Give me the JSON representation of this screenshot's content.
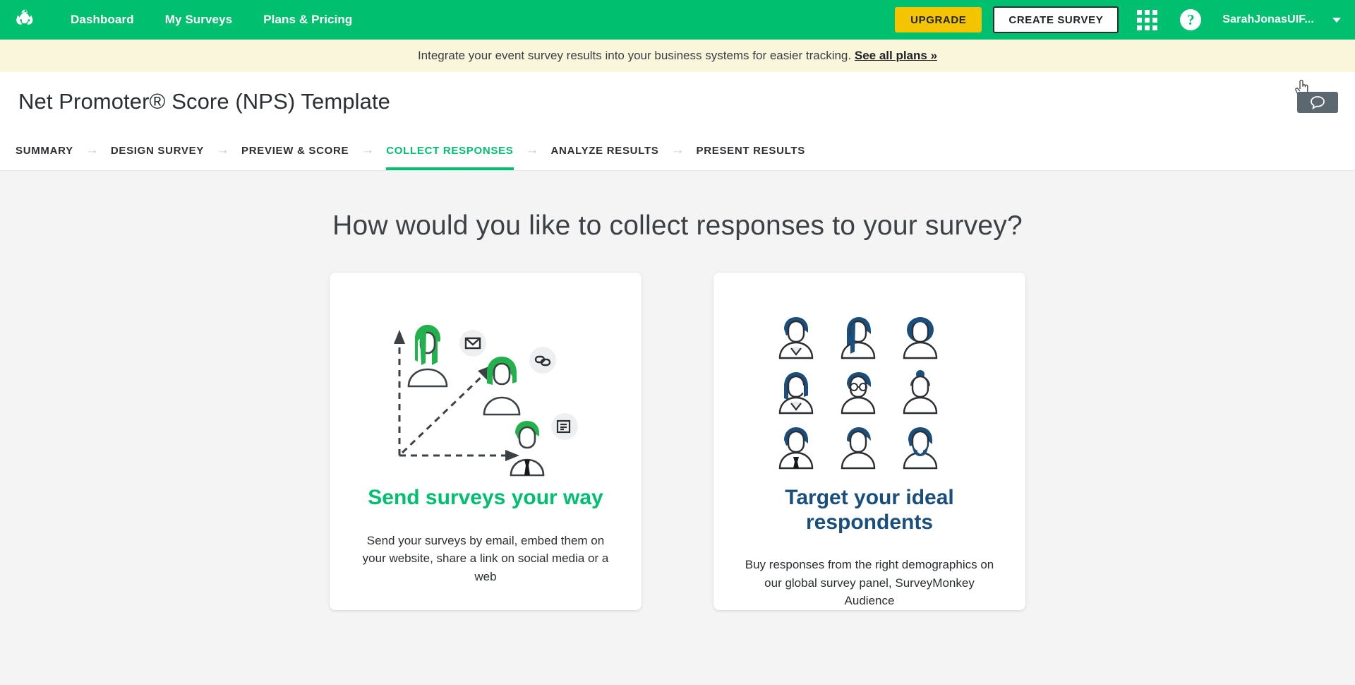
{
  "colors": {
    "brand_green": "#00bf6f",
    "upgrade_yellow": "#f5c400",
    "banner_bg": "#faf6dc",
    "navy": "#1a4f7d",
    "page_bg": "#f4f4f4",
    "feedback_tab": "#5b6870"
  },
  "topnav": {
    "logo_icon": "surveymonkey-logo-icon",
    "links": [
      {
        "label": "Dashboard"
      },
      {
        "label": "My Surveys"
      },
      {
        "label": "Plans & Pricing"
      }
    ],
    "upgrade_label": "UPGRADE",
    "create_survey_label": "CREATE SURVEY",
    "grid_icon": "apps-grid-icon",
    "help_icon": "help-question-icon",
    "help_glyph": "?",
    "username": "SarahJonasUIF...",
    "caret_icon": "chevron-down-icon"
  },
  "banner": {
    "text": "Integrate your event survey results into your business systems for easier tracking.",
    "link_label": "See all plans »"
  },
  "titlebar": {
    "title": "Net Promoter® Score (NPS) Template",
    "feedback_icon": "speech-bubble-icon",
    "cursor_icon": "pointing-hand-cursor-icon"
  },
  "tabs": {
    "separator": "→",
    "items": [
      {
        "label": "SUMMARY",
        "active": false
      },
      {
        "label": "DESIGN SURVEY",
        "active": false
      },
      {
        "label": "PREVIEW & SCORE",
        "active": false
      },
      {
        "label": "COLLECT RESPONSES",
        "active": true
      },
      {
        "label": "ANALYZE RESULTS",
        "active": false
      },
      {
        "label": "PRESENT RESULTS",
        "active": false
      }
    ]
  },
  "main": {
    "heading": "How would you like to collect responses to your survey?",
    "cards": [
      {
        "id": "send-surveys-your-way",
        "title": "Send surveys your way",
        "body": "Send your surveys by email, embed them on your website, share a link on social media or a web",
        "illustration": "people-channels-growth-chart-illustration",
        "badges": [
          "envelope-icon",
          "link-icon",
          "document-icon"
        ]
      },
      {
        "id": "target-your-ideal-respondents",
        "title": "Target your ideal respondents",
        "body": "Buy responses from the right demographics on our global survey panel, SurveyMonkey Audience",
        "illustration": "nine-avatars-grid-illustration"
      }
    ]
  }
}
